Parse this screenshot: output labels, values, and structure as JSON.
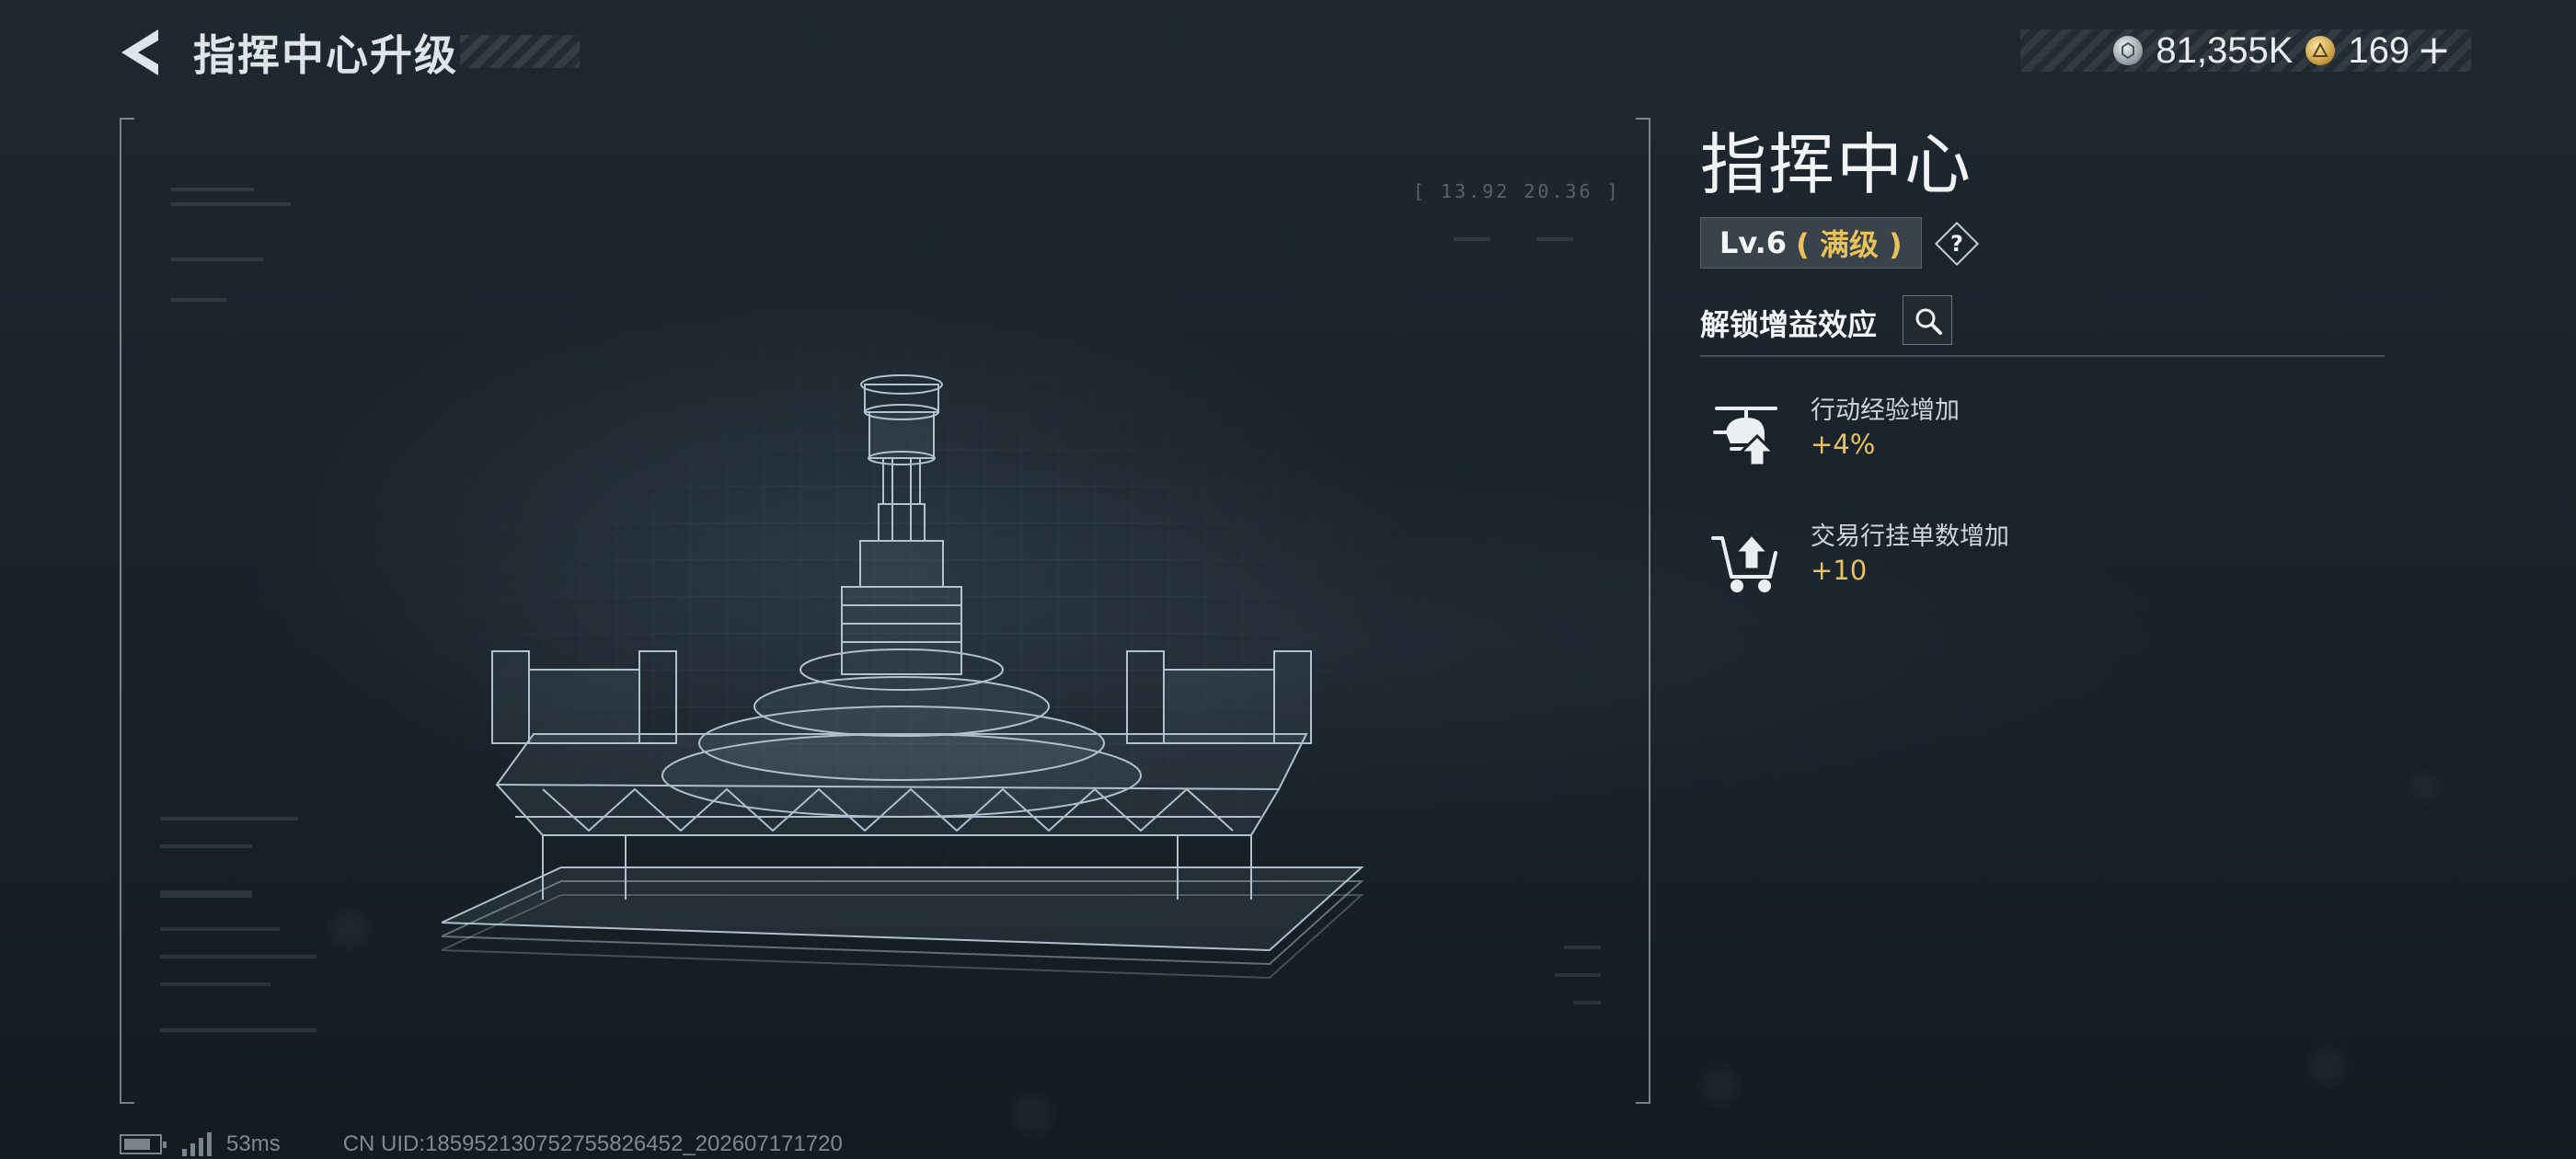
{
  "header": {
    "title": "指挥中心升级"
  },
  "currency": {
    "silver": "81,355K",
    "gold": "169"
  },
  "viewer": {
    "hud_coords": "[ 13.92   20.36 ]"
  },
  "building": {
    "name": "指挥中心",
    "level": "Lv.6",
    "level_status": "( 满级 )",
    "help": "?"
  },
  "buffs": {
    "title": "解锁增益效应",
    "items": [
      {
        "label": "行动经验增加",
        "value": "+4%",
        "icon": "helicopter-upgrade-icon"
      },
      {
        "label": "交易行挂单数增加",
        "value": "+10",
        "icon": "cart-upgrade-icon"
      }
    ]
  },
  "footer": {
    "ping": "53ms",
    "uid": "CN UID:18595213075275582645​2_202607171720"
  },
  "colors": {
    "accent_gold": "#e8c25a",
    "background": "#1a232b",
    "badge_bg": "#3a434b"
  }
}
